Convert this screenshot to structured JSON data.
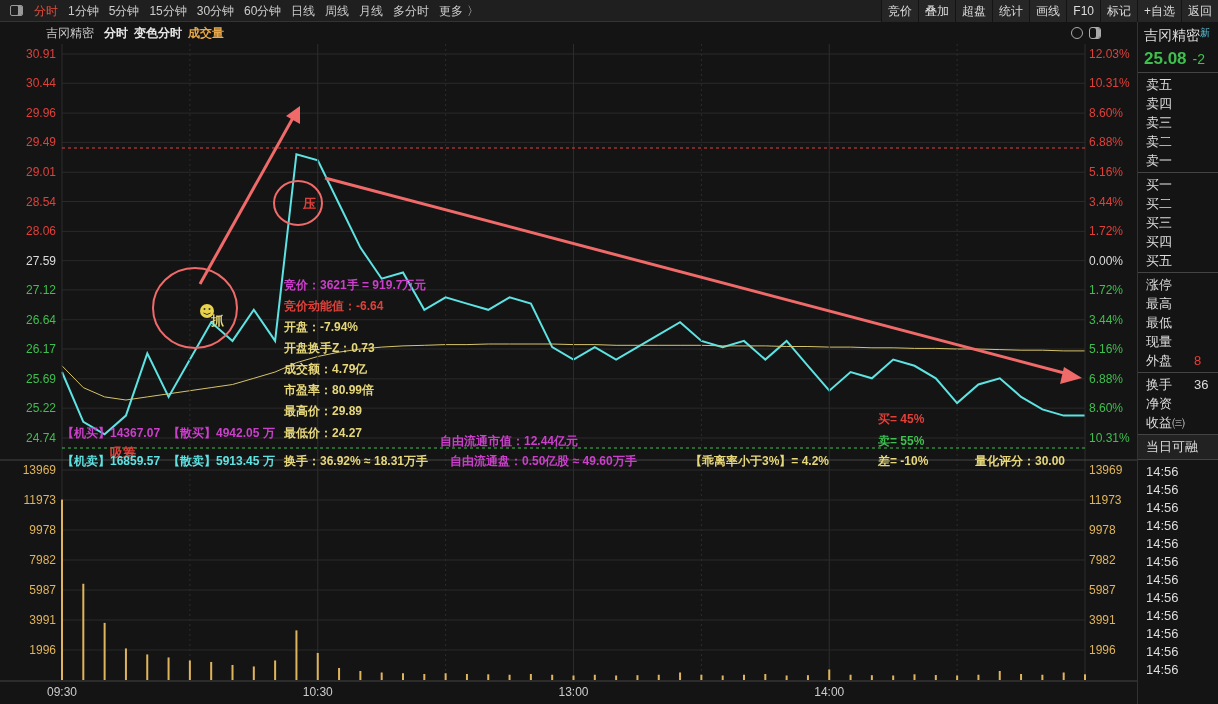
{
  "period_tabs": [
    {
      "label": "分时",
      "selected": true
    },
    {
      "label": "1分钟",
      "selected": false
    },
    {
      "label": "5分钟",
      "selected": false
    },
    {
      "label": "15分钟",
      "selected": false
    },
    {
      "label": "30分钟",
      "selected": false
    },
    {
      "label": "60分钟",
      "selected": false
    },
    {
      "label": "日线",
      "selected": false
    },
    {
      "label": "周线",
      "selected": false
    },
    {
      "label": "月线",
      "selected": false
    },
    {
      "label": "多分时",
      "selected": false
    },
    {
      "label": "更多 〉",
      "selected": false
    }
  ],
  "toolbar_buttons": [
    "竞价",
    "叠加",
    "超盘",
    "统计",
    "画线",
    "F10",
    "标记",
    "+自选",
    "返回"
  ],
  "chart_header": {
    "stock": "吉冈精密",
    "items": [
      {
        "label": "分时",
        "color": "#e8e8e8"
      },
      {
        "label": "变色分时",
        "color": "#e8e8e8"
      },
      {
        "label": "成交量",
        "color": "#e8a94a"
      }
    ]
  },
  "right_axis": [
    {
      "label": "12.03%",
      "kind": "up"
    },
    {
      "label": "10.31%",
      "kind": "up"
    },
    {
      "label": "8.60%",
      "kind": "up"
    },
    {
      "label": "6.88%",
      "kind": "up"
    },
    {
      "label": "5.16%",
      "kind": "up"
    },
    {
      "label": "3.44%",
      "kind": "up"
    },
    {
      "label": "1.72%",
      "kind": "up"
    },
    {
      "label": "0.00%",
      "kind": "flat"
    },
    {
      "label": "1.72%",
      "kind": "down"
    },
    {
      "label": "3.44%",
      "kind": "down"
    },
    {
      "label": "5.16%",
      "kind": "down"
    },
    {
      "label": "6.88%",
      "kind": "down"
    },
    {
      "label": "8.60%",
      "kind": "down"
    },
    {
      "label": "10.31%",
      "kind": "down"
    }
  ],
  "price_chart": {
    "chart_data": {
      "type": "line",
      "grid": true,
      "series": [
        {
          "color": "#5ee3e3",
          "values": [
            25.8,
            25.0,
            24.8,
            25.1,
            26.1,
            25.4,
            26.0,
            26.6,
            26.3,
            26.8,
            26.3,
            29.3,
            29.2,
            28.5,
            27.8,
            27.3,
            27.4,
            26.8,
            27.0,
            26.9,
            26.8,
            27.0,
            26.9,
            26.2,
            26.0,
            26.2,
            26.0,
            26.2,
            26.4,
            26.6,
            26.3,
            26.2,
            26.3,
            26.0,
            26.3,
            25.9,
            25.5,
            25.8,
            25.7,
            26.0,
            25.9,
            25.7,
            25.3,
            25.6,
            25.7,
            25.4,
            25.2,
            25.1,
            25.1
          ]
        },
        {
          "color": "#d6c36a",
          "values": [
            25.9,
            25.55,
            25.4,
            25.35,
            25.4,
            25.45,
            25.5,
            25.55,
            25.6,
            25.7,
            25.8,
            25.95,
            26.05,
            26.12,
            26.17,
            26.2,
            26.22,
            26.23,
            26.24,
            26.24,
            26.25,
            26.25,
            26.25,
            26.25,
            26.24,
            26.24,
            26.23,
            26.23,
            26.23,
            26.23,
            26.23,
            26.22,
            26.22,
            26.22,
            26.21,
            26.21,
            26.2,
            26.2,
            26.19,
            26.19,
            26.18,
            26.18,
            26.17,
            26.17,
            26.16,
            26.15,
            26.15,
            26.14,
            26.14
          ]
        }
      ],
      "ylim": [
        24.74,
        30.91
      ],
      "yticks": [
        {
          "value": 30.91,
          "label": "30.91"
        },
        {
          "value": 30.44,
          "label": "30.44"
        },
        {
          "value": 29.96,
          "label": "29.96"
        },
        {
          "value": 29.49,
          "label": "29.49"
        },
        {
          "value": 29.01,
          "label": "29.01"
        },
        {
          "value": 28.54,
          "label": "28.54"
        },
        {
          "value": 28.06,
          "label": "28.06"
        },
        {
          "value": 27.59,
          "label": "27.59"
        },
        {
          "value": 27.12,
          "label": "27.12"
        },
        {
          "value": 26.64,
          "label": "26.64"
        },
        {
          "value": 26.17,
          "label": "26.17"
        },
        {
          "value": 25.69,
          "label": "25.69"
        },
        {
          "value": 25.22,
          "label": "25.22"
        },
        {
          "value": 24.74,
          "label": "24.74"
        }
      ]
    }
  },
  "chart_notes": [
    {
      "text": "压",
      "color": "#e0403a"
    },
    {
      "text": "竞价：3621手 = 919.7万元",
      "color": "#cc3fcc"
    },
    {
      "text": "竞价动能值：-6.64",
      "color": "#e0403a"
    },
    {
      "text": "抓",
      "color": "#e6d77a"
    },
    {
      "text": "开盘：-7.94%",
      "color": "#e6d77a"
    },
    {
      "text": "开盘换手Z：0.73",
      "color": "#e6d77a"
    },
    {
      "text": "成交额：4.79亿",
      "color": "#e6d77a"
    },
    {
      "text": "市盈率：80.99倍",
      "color": "#e6d77a"
    },
    {
      "text": "最高价：29.89",
      "color": "#e6d77a"
    },
    {
      "text": "买= 45%",
      "color": "#e0403a"
    },
    {
      "text": "【机买】14367.07",
      "color": "#cc3fcc"
    },
    {
      "text": "【散买】4942.05 万",
      "color": "#cc3fcc"
    },
    {
      "text": "最低价：24.27",
      "color": "#e6d77a"
    },
    {
      "text": "自由流通市值：12.44亿元",
      "color": "#cc3fcc"
    },
    {
      "text": "卖= 55%",
      "color": "#3fbf4f"
    },
    {
      "text": "吸筹",
      "color": "#e0403a"
    },
    {
      "text": "【机卖】16859.57",
      "color": "#5ee3e3"
    },
    {
      "text": "【散卖】5913.45 万",
      "color": "#5ee3e3"
    },
    {
      "text": "换手：36.92% ≈ 18.31万手",
      "color": "#e6d77a"
    },
    {
      "text": "自由流通盘：0.50亿股 ≈ 49.60万手",
      "color": "#cc3fcc"
    },
    {
      "text": "【乖离率小于3%】= 4.2%",
      "color": "#e6d77a"
    },
    {
      "text": "差= -10%",
      "color": "#e6d77a"
    },
    {
      "text": "量化评分：30.00",
      "color": "#e6d77a"
    }
  ],
  "volume_chart": {
    "chart_data": {
      "type": "bar",
      "grid": true,
      "categories": [
        "09:30",
        null,
        null,
        null,
        null,
        null,
        null,
        null,
        null,
        null,
        null,
        null,
        "10:30",
        null,
        null,
        null,
        null,
        null,
        null,
        null,
        null,
        null,
        null,
        null,
        "13:00",
        null,
        null,
        null,
        null,
        null,
        null,
        null,
        null,
        null,
        null,
        null,
        "14:00",
        null,
        null,
        null,
        null,
        null,
        null,
        null,
        null,
        null,
        null,
        null,
        null
      ],
      "values": [
        12000,
        6400,
        3800,
        2100,
        1700,
        1500,
        1300,
        1200,
        1000,
        900,
        1300,
        3300,
        1800,
        800,
        600,
        500,
        450,
        400,
        450,
        400,
        380,
        350,
        400,
        350,
        300,
        350,
        300,
        320,
        350,
        500,
        350,
        300,
        350,
        400,
        300,
        320,
        700,
        350,
        320,
        300,
        380,
        330,
        300,
        350,
        600,
        400,
        350,
        500,
        380
      ],
      "color": "#e0b45c",
      "ylim": [
        0,
        13969
      ],
      "yticks": [
        {
          "value": 13969,
          "label": "13969"
        },
        {
          "value": 11973,
          "label": "11973"
        },
        {
          "value": 9978,
          "label": "9978"
        },
        {
          "value": 7982,
          "label": "7982"
        },
        {
          "value": 5987,
          "label": "5987"
        },
        {
          "value": 3991,
          "label": "3991"
        },
        {
          "value": 1996,
          "label": "1996"
        }
      ]
    }
  },
  "quote_panel": {
    "name": "吉冈精密",
    "tag": "新",
    "price": "25.08",
    "change": "-2",
    "groups": [
      [
        {
          "label": "卖五"
        },
        {
          "label": "卖四"
        },
        {
          "label": "卖三"
        },
        {
          "label": "卖二"
        },
        {
          "label": "卖一"
        }
      ],
      [
        {
          "label": "买一"
        },
        {
          "label": "买二"
        },
        {
          "label": "买三"
        },
        {
          "label": "买四"
        },
        {
          "label": "买五"
        }
      ],
      [
        {
          "label": "涨停"
        },
        {
          "label": "最高"
        },
        {
          "label": "最低"
        },
        {
          "label": "现量"
        },
        {
          "label": "外盘",
          "value": "8"
        }
      ],
      [
        {
          "label": "换手",
          "value": "36"
        },
        {
          "label": "净资"
        },
        {
          "label": "收益㈢"
        }
      ]
    ],
    "margin_title": "当日可融",
    "times": [
      "14:56",
      "14:56",
      "14:56",
      "14:56",
      "14:56",
      "14:56",
      "14:56",
      "14:56",
      "14:56",
      "14:56",
      "14:56",
      "14:56"
    ]
  }
}
